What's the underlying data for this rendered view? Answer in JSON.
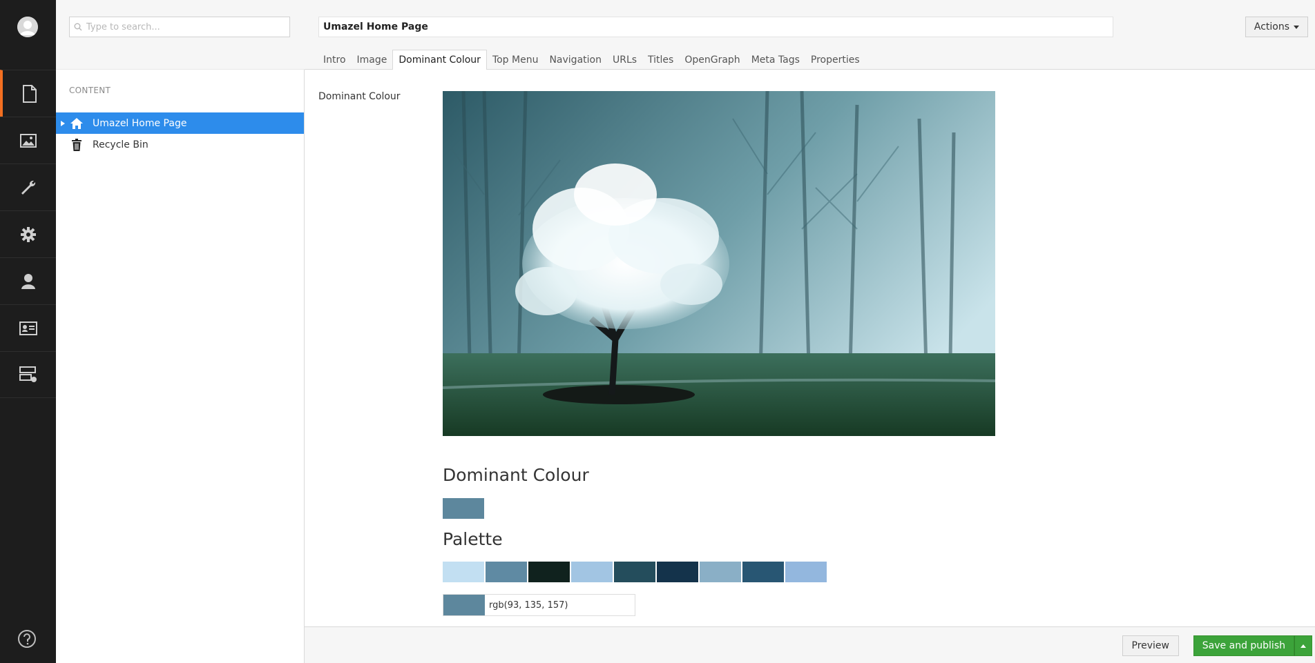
{
  "search": {
    "placeholder": "Type to search..."
  },
  "tree": {
    "section_title": "CONTENT",
    "nodes": [
      {
        "label": "Umazel Home Page",
        "icon": "home-icon",
        "selected": true
      },
      {
        "label": "Recycle Bin",
        "icon": "trash-icon",
        "selected": false
      }
    ]
  },
  "rail": {
    "sections": [
      "content-icon",
      "media-icon",
      "settings-wrench-icon",
      "developer-gear-icon",
      "users-icon",
      "members-icon",
      "forms-icon"
    ],
    "active": "content-icon",
    "help_icon": "help-icon"
  },
  "editor": {
    "node_name": "Umazel Home Page",
    "actions_label": "Actions",
    "tabs": [
      "Intro",
      "Image",
      "Dominant Colour",
      "Top Menu",
      "Navigation",
      "URLs",
      "Titles",
      "OpenGraph",
      "Meta Tags",
      "Properties"
    ],
    "active_tab": "Dominant Colour",
    "property_label": "Dominant Colour",
    "dominant_heading": "Dominant Colour",
    "dominant_color": "#5d879d",
    "palette_heading": "Palette",
    "palette": [
      "#c2dff2",
      "#5f8aa3",
      "#10221e",
      "#a2c5e3",
      "#244d5c",
      "#14334b",
      "#8aafc6",
      "#285673",
      "#93b7de"
    ],
    "selected_color_text": "rgb(93, 135, 157)",
    "selected_color": "#5d879d"
  },
  "footer": {
    "preview_label": "Preview",
    "publish_label": "Save and publish"
  },
  "colors": {
    "accent": "#f36f21",
    "selection": "#2d8ceb",
    "publish": "#3ca33a",
    "rail": "#1d1d1d"
  }
}
